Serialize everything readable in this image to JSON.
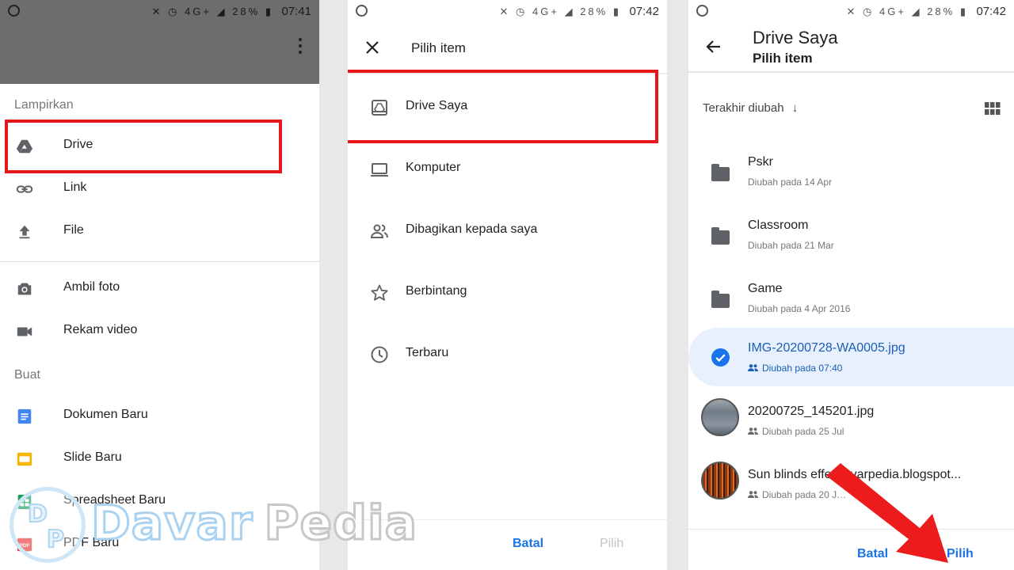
{
  "status_left": {
    "battery": "28%",
    "time": "07:41",
    "net": "4G+"
  },
  "status_mid": {
    "battery": "28%",
    "time": "07:42",
    "net": "4G+"
  },
  "status_right": {
    "battery": "28%",
    "time": "07:42",
    "net": "4G+"
  },
  "attach": {
    "section_attach": "Lampirkan",
    "section_create": "Buat",
    "items": [
      {
        "label": "Drive",
        "icon": "drive-icon"
      },
      {
        "label": "Link",
        "icon": "link-icon"
      },
      {
        "label": "File",
        "icon": "upload-icon"
      },
      {
        "label": "Ambil foto",
        "icon": "camera-icon"
      },
      {
        "label": "Rekam video",
        "icon": "videocam-icon"
      }
    ],
    "create_items": [
      {
        "label": "Dokumen Baru",
        "icon": "docs-icon",
        "color": "#4285f4"
      },
      {
        "label": "Slide Baru",
        "icon": "slides-icon",
        "color": "#f4b400"
      },
      {
        "label": "Spreadsheet Baru",
        "icon": "sheets-icon",
        "color": "#0f9d58"
      },
      {
        "label": "PDF Baru",
        "icon": "pdf-icon",
        "color": "#e53935"
      }
    ]
  },
  "picker": {
    "title": "Pilih item",
    "items": [
      {
        "label": "Drive Saya",
        "icon": "my-drive-icon"
      },
      {
        "label": "Komputer",
        "icon": "laptop-icon"
      },
      {
        "label": "Dibagikan kepada saya",
        "icon": "people-icon"
      },
      {
        "label": "Berbintang",
        "icon": "star-icon"
      },
      {
        "label": "Terbaru",
        "icon": "clock-icon"
      }
    ],
    "cancel": "Batal",
    "select": "Pilih"
  },
  "drive": {
    "title": "Drive Saya",
    "subtitle": "Pilih item",
    "sort_label": "Terakhir diubah",
    "files": [
      {
        "name": "Pskr",
        "date": "Diubah pada 14 Apr",
        "type": "folder"
      },
      {
        "name": "Classroom",
        "date": "Diubah pada 21 Mar",
        "type": "folder"
      },
      {
        "name": "Game",
        "date": "Diubah pada 4 Apr 2016",
        "type": "folder"
      },
      {
        "name": "IMG-20200728-WA0005.jpg",
        "date": "Diubah pada 07:40",
        "type": "image",
        "selected": true
      },
      {
        "name": "20200725_145201.jpg",
        "date": "Diubah pada 25 Jul",
        "type": "image"
      },
      {
        "name": "Sun blinds effec…varpedia.blogspot...",
        "date": "Diubah pada 20 J…",
        "type": "image"
      }
    ],
    "cancel": "Batal",
    "select": "Pilih"
  },
  "watermark": {
    "logo_letters": [
      "D",
      "P"
    ],
    "word1": "Davar",
    "word2": "Pedia"
  },
  "colors": {
    "accent_red": "#e5171b",
    "blue": "#1a73e8",
    "selected_bg": "#e8f0fe"
  }
}
